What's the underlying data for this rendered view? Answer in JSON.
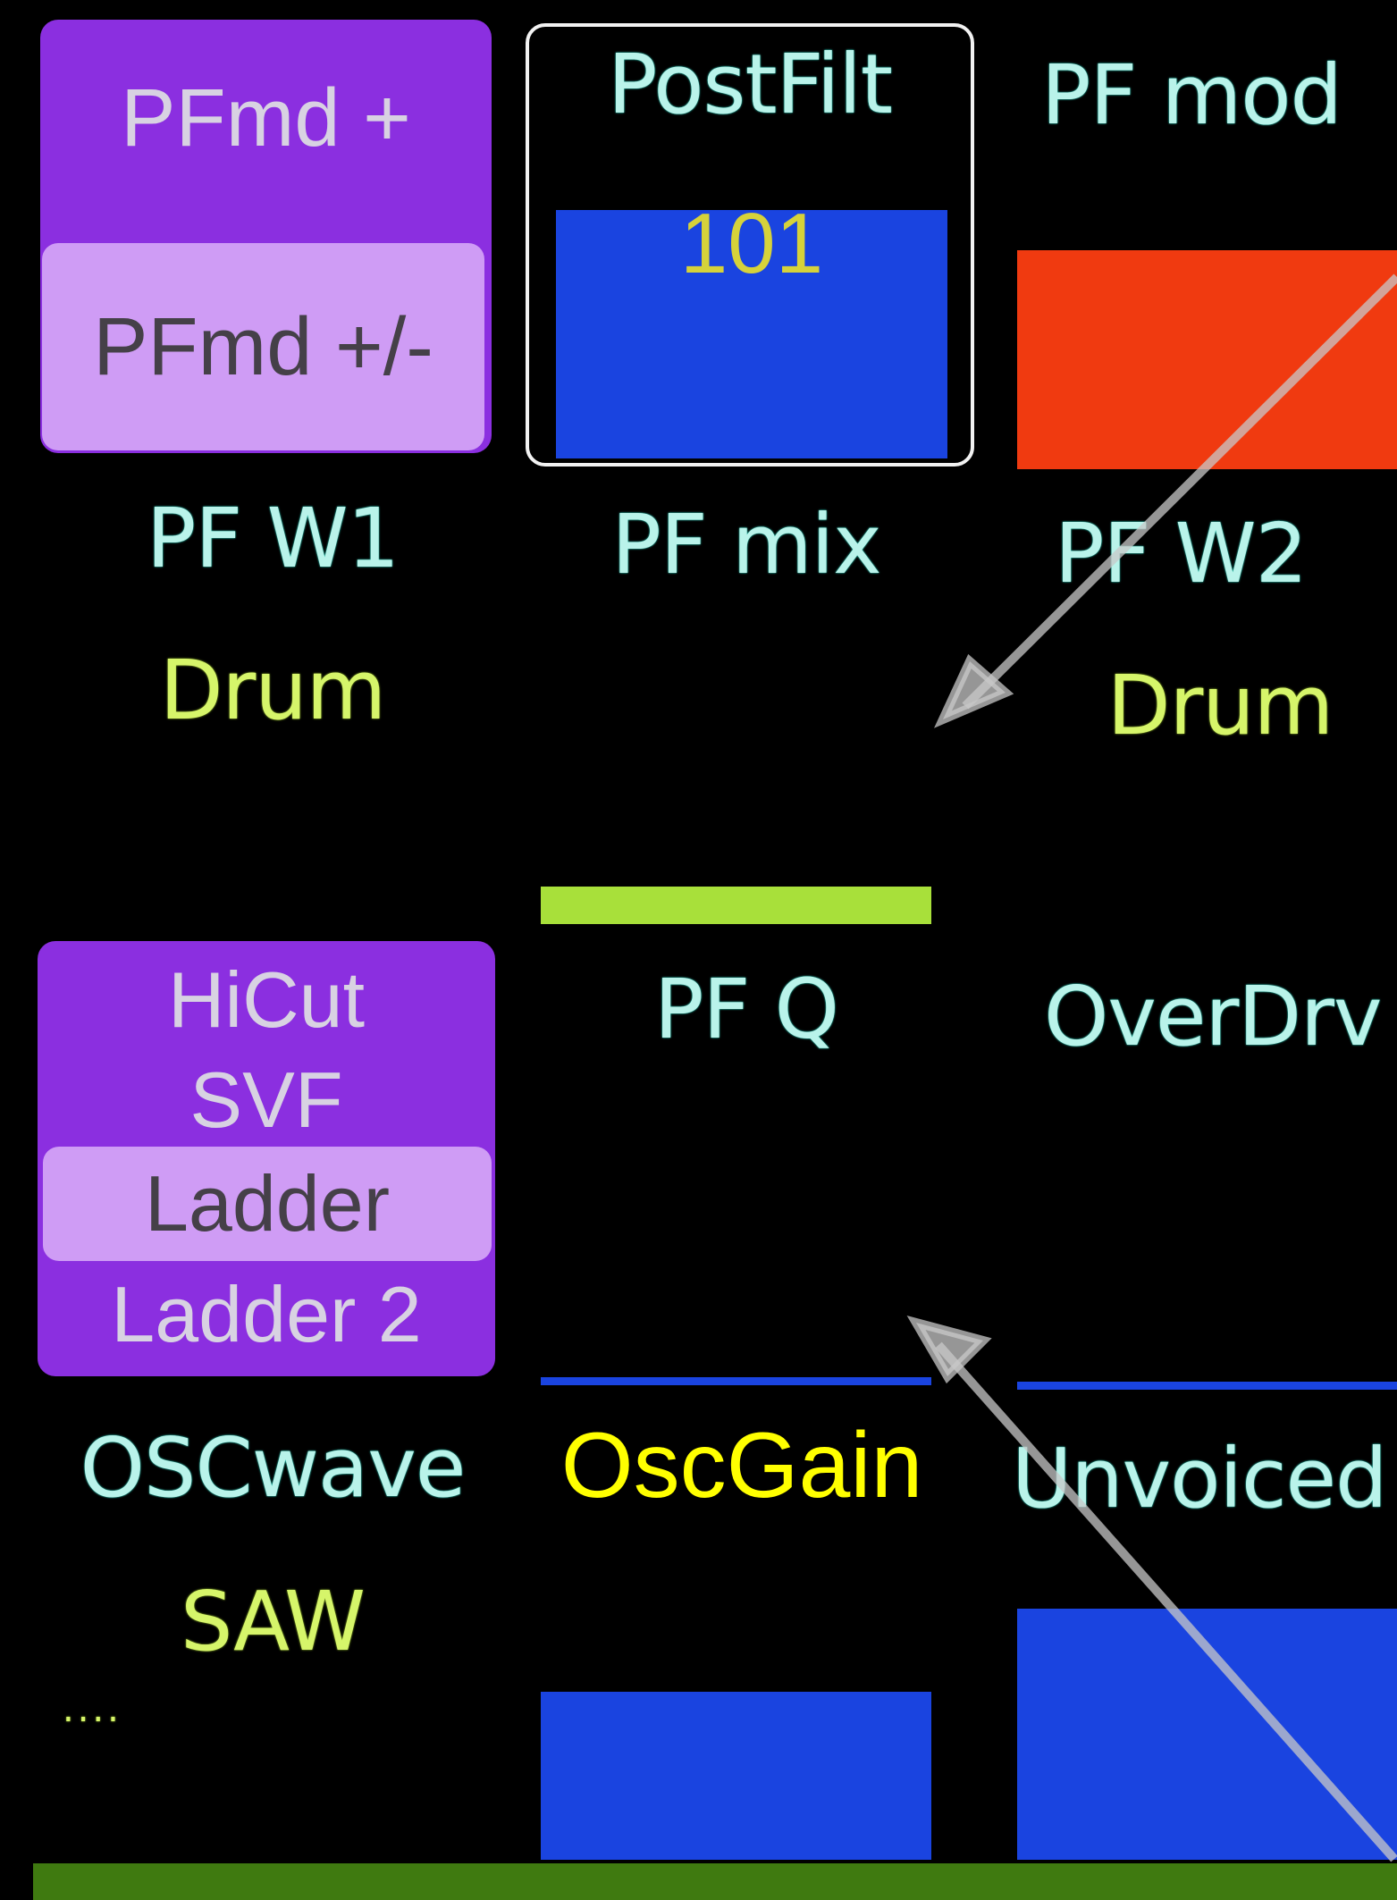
{
  "pf_mod_menu": {
    "items": [
      "PFmd +",
      "PFmd +/-"
    ],
    "selected": "PFmd +/-"
  },
  "filter_menu": {
    "items": [
      "HiCut",
      "SVF",
      "Ladder",
      "Ladder 2"
    ],
    "selected": "Ladder"
  },
  "params": {
    "postfilt": {
      "label": "PostFilt",
      "value": "101"
    },
    "pf_mod": {
      "label": "PF mod"
    },
    "pf_w1": {
      "label": "PF W1",
      "value": "Drum"
    },
    "pf_mix": {
      "label": "PF mix"
    },
    "pf_w2": {
      "label": "PF W2",
      "value": "Drum"
    },
    "pf_q": {
      "label": "PF Q"
    },
    "overdrv": {
      "label": "OverDrv"
    },
    "oscwave": {
      "label": "OSCwave",
      "value": "SAW",
      "more": "...."
    },
    "oscgain": {
      "label": "OscGain"
    },
    "unvoiced": {
      "label": "Unvoiced"
    }
  },
  "colors": {
    "menu_bg": "#8b2fe0",
    "menu_selected_bg": "#cf9cf5",
    "param_label": "#b9f3ea",
    "param_value": "#d6f56a",
    "bar_blue": "#1a44e0",
    "bar_red": "#f03a10",
    "bar_lime": "#a8e03a",
    "highlight_label": "#ffff00",
    "bottom_strip": "#3f7a10"
  }
}
